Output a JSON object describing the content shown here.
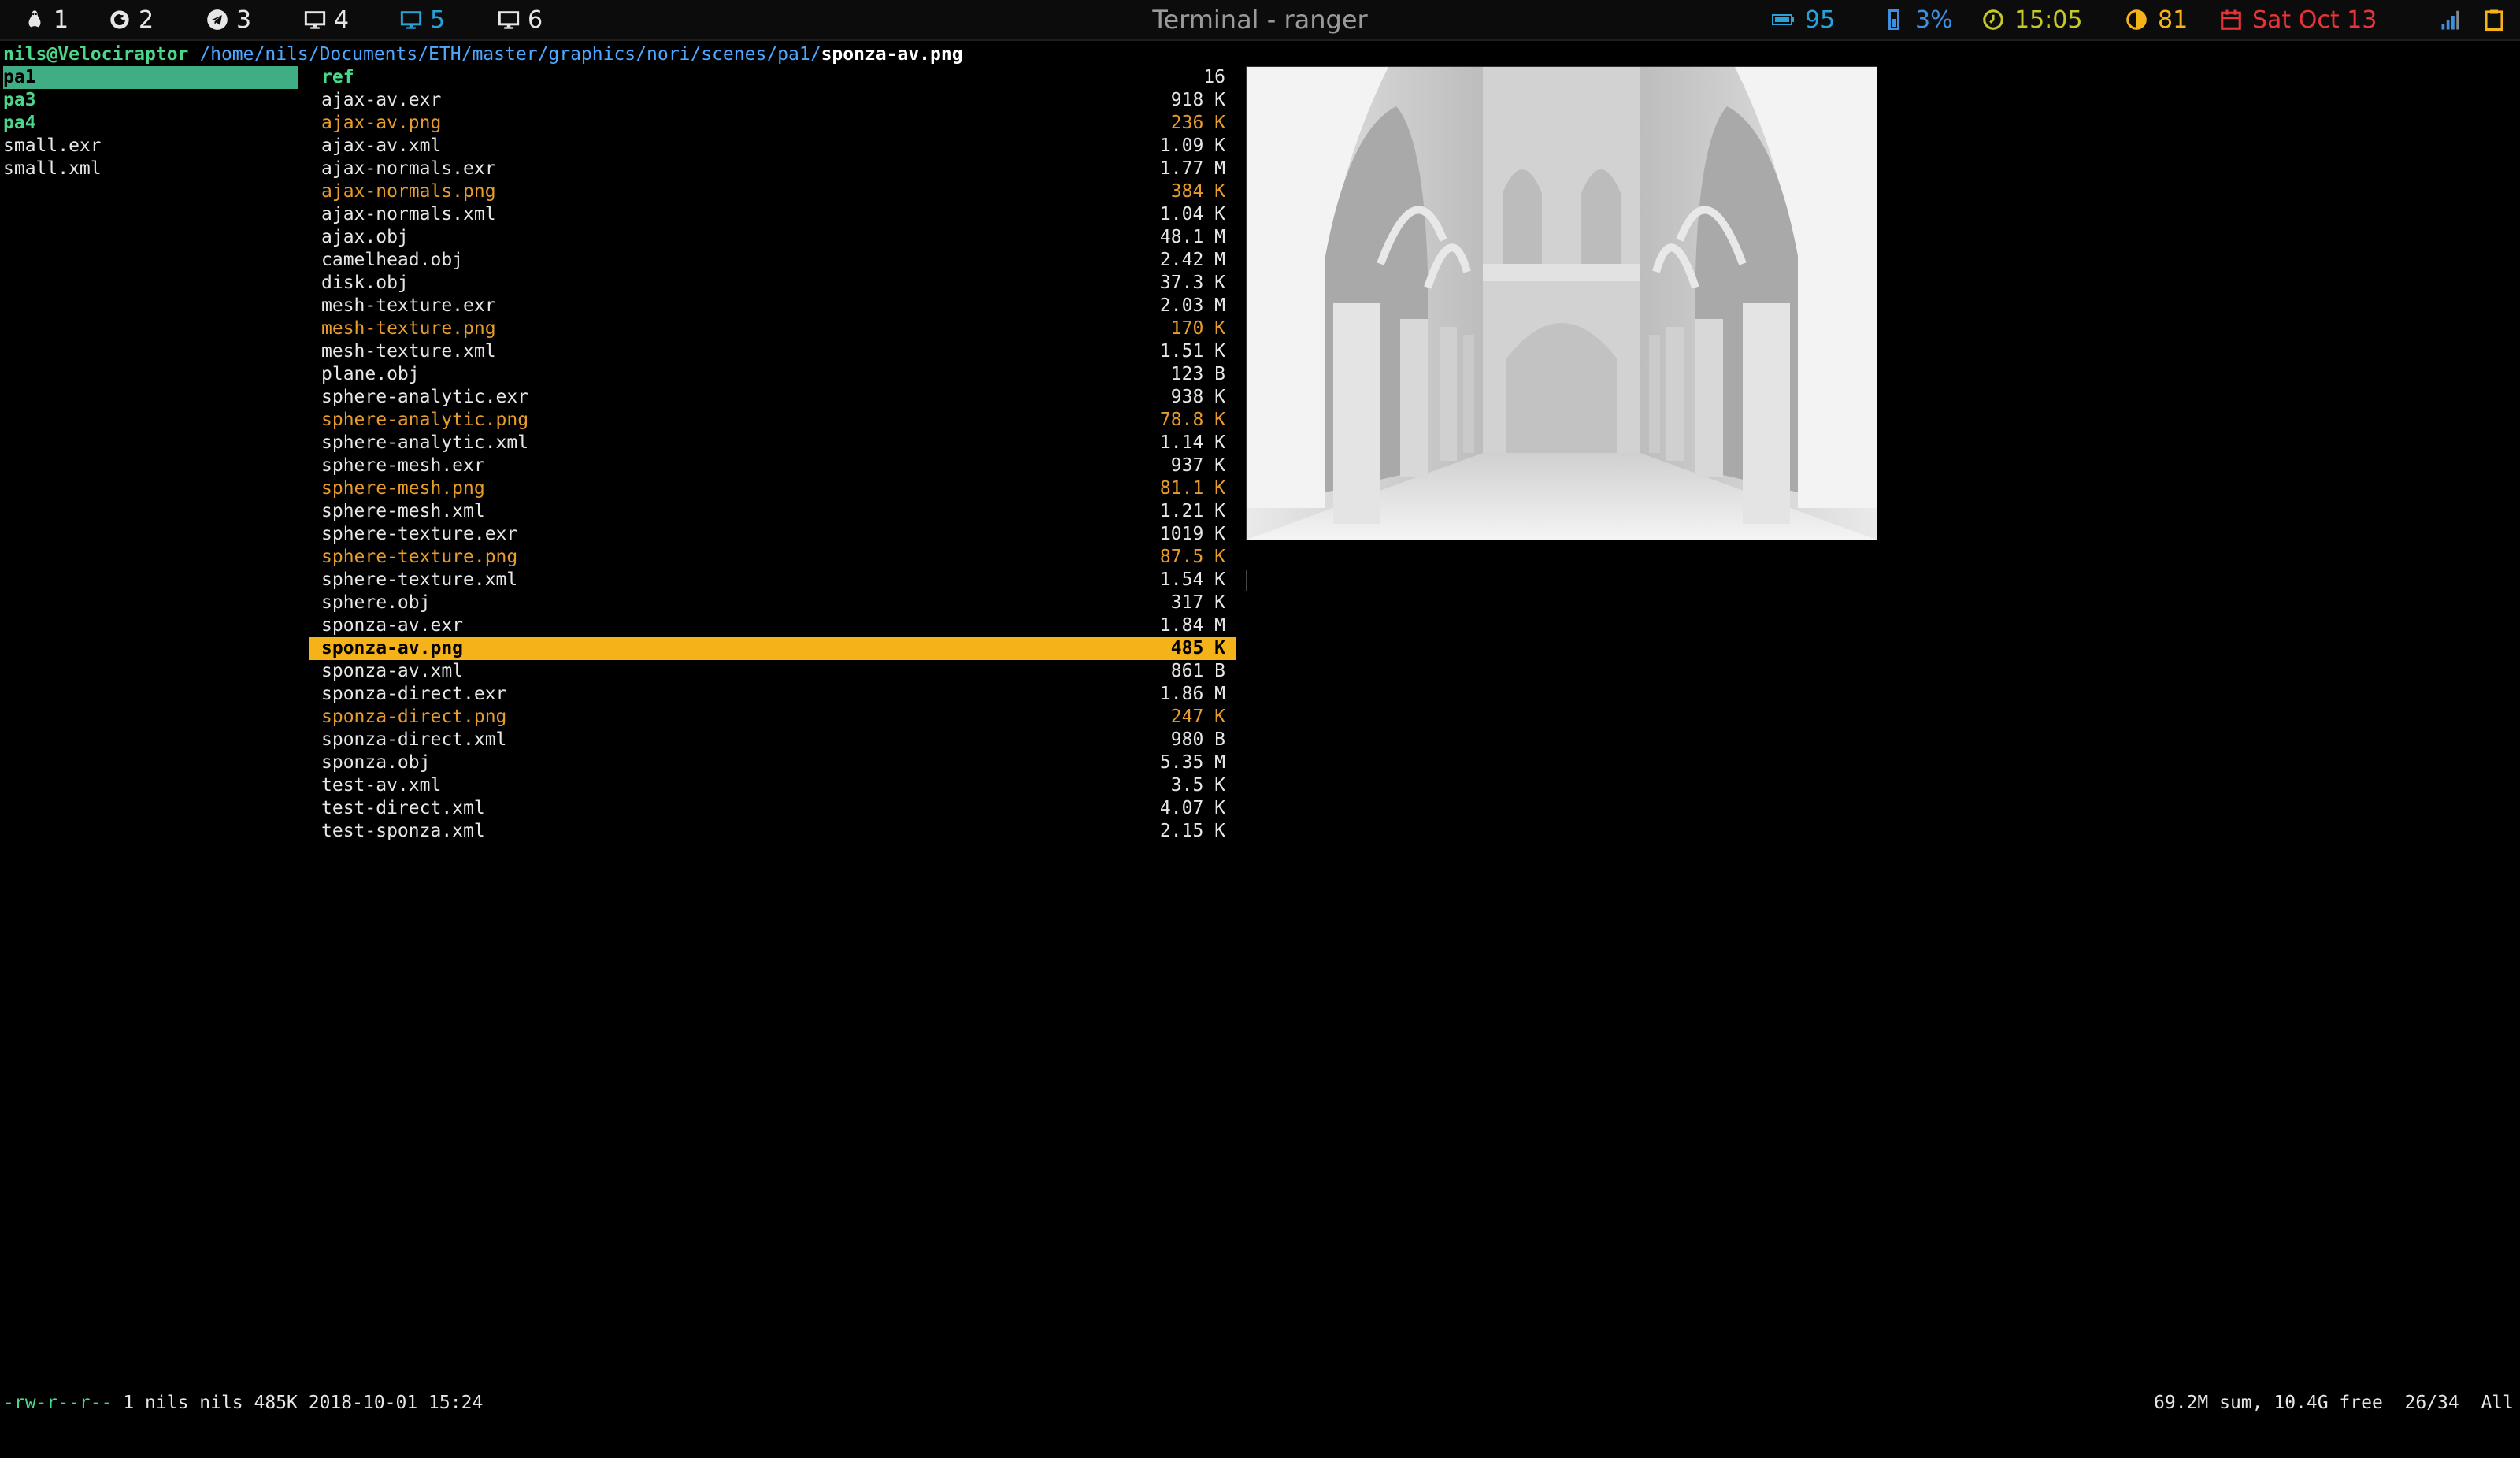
{
  "topbar": {
    "workspaces": [
      {
        "num": "1",
        "icon": "linux-tux-icon"
      },
      {
        "num": "2",
        "icon": "firefox-icon"
      },
      {
        "num": "3",
        "icon": "telegram-icon"
      },
      {
        "num": "4",
        "icon": "monitor-icon"
      },
      {
        "num": "5",
        "icon": "monitor-icon",
        "active": true
      },
      {
        "num": "6",
        "icon": "monitor-icon"
      }
    ],
    "title": "Terminal - ranger",
    "battery": "95",
    "cpu": "3%",
    "time": "15:05",
    "brightness": "81",
    "date": "Sat Oct 13",
    "colors": {
      "cyan": "#27a3d9",
      "green": "#4cd68a",
      "yellow": "#c7c72a",
      "orange": "#f5b219",
      "red": "#e8333a"
    }
  },
  "pathline": {
    "host": "nils@Velociraptor",
    "dir": "/home/nils/Documents/ETH/master/graphics/nori/scenes/pa1/",
    "file": "sponza-av.png"
  },
  "parent": [
    {
      "name": "pa1",
      "type": "dir",
      "selected": true
    },
    {
      "name": "pa3",
      "type": "dir"
    },
    {
      "name": "pa4",
      "type": "dir"
    },
    {
      "name": "small.exr",
      "type": "file"
    },
    {
      "name": "small.xml",
      "type": "file"
    }
  ],
  "files": [
    {
      "name": "ref",
      "size": "16",
      "type": "dir"
    },
    {
      "name": "ajax-av.exr",
      "size": "918 K"
    },
    {
      "name": "ajax-av.png",
      "size": "236 K",
      "type": "img"
    },
    {
      "name": "ajax-av.xml",
      "size": "1.09 K"
    },
    {
      "name": "ajax-normals.exr",
      "size": "1.77 M"
    },
    {
      "name": "ajax-normals.png",
      "size": "384 K",
      "type": "img"
    },
    {
      "name": "ajax-normals.xml",
      "size": "1.04 K"
    },
    {
      "name": "ajax.obj",
      "size": "48.1 M"
    },
    {
      "name": "camelhead.obj",
      "size": "2.42 M"
    },
    {
      "name": "disk.obj",
      "size": "37.3 K"
    },
    {
      "name": "mesh-texture.exr",
      "size": "2.03 M"
    },
    {
      "name": "mesh-texture.png",
      "size": "170 K",
      "type": "img"
    },
    {
      "name": "mesh-texture.xml",
      "size": "1.51 K"
    },
    {
      "name": "plane.obj",
      "size": "123 B"
    },
    {
      "name": "sphere-analytic.exr",
      "size": "938 K"
    },
    {
      "name": "sphere-analytic.png",
      "size": "78.8 K",
      "type": "img"
    },
    {
      "name": "sphere-analytic.xml",
      "size": "1.14 K"
    },
    {
      "name": "sphere-mesh.exr",
      "size": "937 K"
    },
    {
      "name": "sphere-mesh.png",
      "size": "81.1 K",
      "type": "img"
    },
    {
      "name": "sphere-mesh.xml",
      "size": "1.21 K"
    },
    {
      "name": "sphere-texture.exr",
      "size": "1019 K"
    },
    {
      "name": "sphere-texture.png",
      "size": "87.5 K",
      "type": "img"
    },
    {
      "name": "sphere-texture.xml",
      "size": "1.54 K"
    },
    {
      "name": "sphere.obj",
      "size": "317 K"
    },
    {
      "name": "sponza-av.exr",
      "size": "1.84 M"
    },
    {
      "name": "sponza-av.png",
      "size": "485 K",
      "type": "img",
      "selected": true
    },
    {
      "name": "sponza-av.xml",
      "size": "861 B"
    },
    {
      "name": "sponza-direct.exr",
      "size": "1.86 M"
    },
    {
      "name": "sponza-direct.png",
      "size": "247 K",
      "type": "img"
    },
    {
      "name": "sponza-direct.xml",
      "size": "980 B"
    },
    {
      "name": "sponza.obj",
      "size": "5.35 M"
    },
    {
      "name": "test-av.xml",
      "size": "3.5 K"
    },
    {
      "name": "test-direct.xml",
      "size": "4.07 K"
    },
    {
      "name": "test-sponza.xml",
      "size": "2.15 K"
    }
  ],
  "status": {
    "perms": "-rw-r--r--",
    "info": " 1 nils nils 485K 2018-10-01 15:24",
    "right": "69.2M sum, 10.4G free  26/34  All"
  }
}
